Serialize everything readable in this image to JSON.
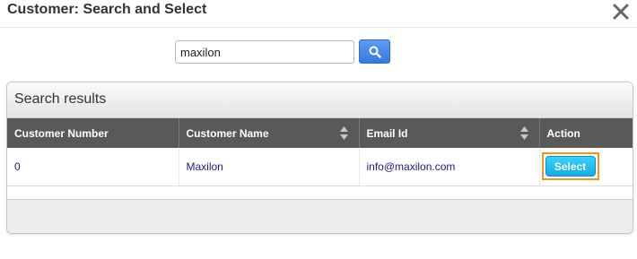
{
  "dialog": {
    "title": "Customer: Search and Select"
  },
  "search": {
    "value": "maxilon"
  },
  "results": {
    "title": "Search results",
    "columns": [
      "Customer Number",
      "Customer Name",
      "Email Id",
      "Action"
    ],
    "rows": [
      {
        "customer_number": "0",
        "customer_name": "Maxilon",
        "email": "info@maxilon.com",
        "action_label": "Select"
      }
    ]
  }
}
